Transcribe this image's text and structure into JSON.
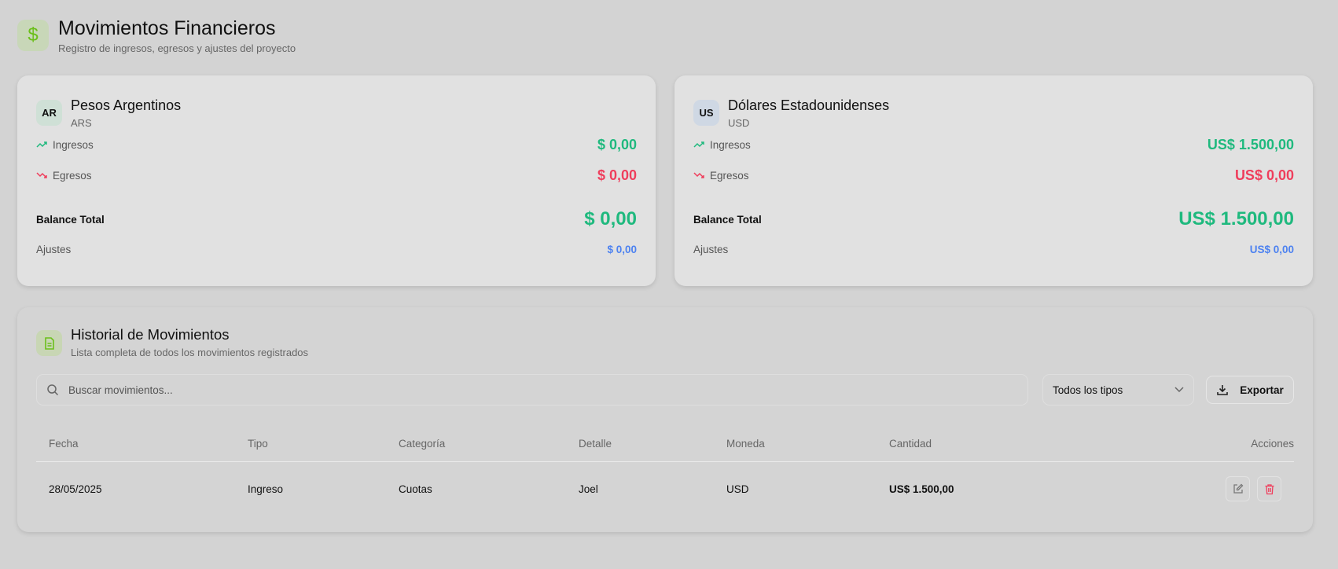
{
  "header": {
    "icon": "dollar-icon",
    "icon_glyph": "$",
    "title": "Movimientos Financieros",
    "subtitle": "Registro de ingresos, egresos y ajustes del proyecto"
  },
  "currencies": [
    {
      "badge": "AR",
      "badge_color": "#cfe0d6",
      "name": "Pesos Argentinos",
      "code": "ARS",
      "income_label": "Ingresos",
      "income": "$ 0,00",
      "expense_label": "Egresos",
      "expense": "$ 0,00",
      "balance_label": "Balance Total",
      "balance": "$ 0,00",
      "adjust_label": "Ajustes",
      "adjust": "$ 0,00"
    },
    {
      "badge": "US",
      "badge_color": "#cfd8e4",
      "name": "Dólares Estadounidenses",
      "code": "USD",
      "income_label": "Ingresos",
      "income": "US$ 1.500,00",
      "expense_label": "Egresos",
      "expense": "US$ 0,00",
      "balance_label": "Balance Total",
      "balance": "US$ 1.500,00",
      "adjust_label": "Ajustes",
      "adjust": "US$ 0,00"
    }
  ],
  "history": {
    "title": "Historial de Movimientos",
    "subtitle": "Lista completa de todos los movimientos registrados",
    "search_placeholder": "Buscar movimientos...",
    "type_filter": "Todos los tipos",
    "export_label": "Exportar",
    "columns": [
      "Fecha",
      "Tipo",
      "Categoría",
      "Detalle",
      "Moneda",
      "Cantidad",
      "Acciones"
    ],
    "rows": [
      [
        "28/05/2025",
        "Ingreso",
        "Cuotas",
        "Joel",
        "USD",
        "US$ 1.500,00"
      ]
    ]
  },
  "colors": {
    "income": "#1fb97e",
    "expense": "#ef3e5c",
    "adjust": "#4d82f0",
    "accent": "#6bbf1a"
  }
}
